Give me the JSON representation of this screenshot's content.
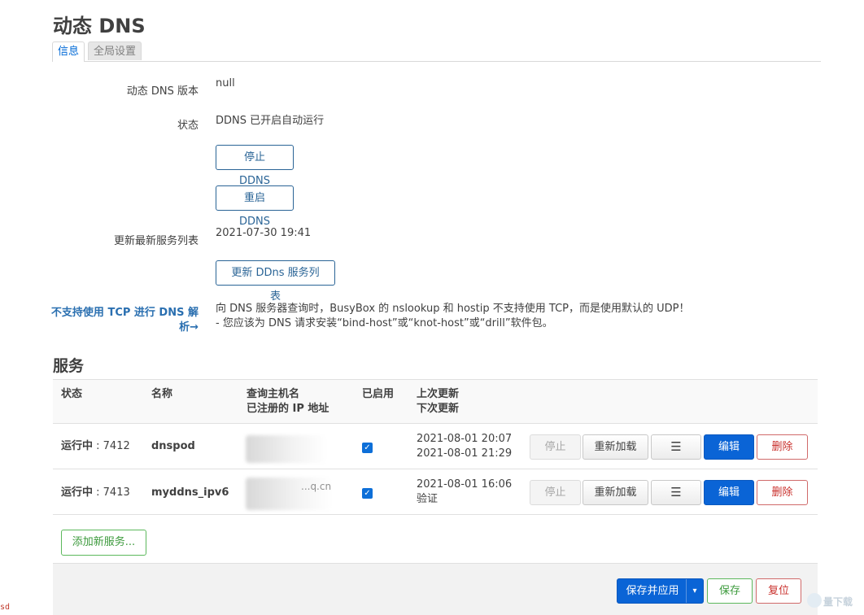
{
  "page": {
    "title": "动态 DNS",
    "tabs": [
      {
        "label": "信息",
        "active": true
      },
      {
        "label": "全局设置",
        "active": false
      }
    ]
  },
  "info": {
    "version_label": "动态 DNS 版本",
    "version_value": "null",
    "status_label": "状态",
    "status_value": "DDNS 已开启自动运行",
    "stop_button": "停止 DDNS",
    "restart_button": "重启 DDNS",
    "update_list_label": "更新最新服务列表",
    "update_list_value": "2021-07-30 19:41",
    "update_list_button": "更新 DDns 服务列表",
    "tcp_warning_label": "不支持使用 TCP 进行 DNS 解析→",
    "tcp_warning_line1": "向 DNS 服务器查询时，BusyBox 的 nslookup 和 hostip 不支持使用 TCP，而是使用默认的 UDP！",
    "tcp_warning_line2": "- 您应该为 DNS 请求安装“bind-host”或“knot-host”或“drill”软件包。"
  },
  "services": {
    "title": "服务",
    "headers": {
      "status": "状态",
      "name": "名称",
      "host_line1": "查询主机名",
      "host_line2": "已注册的 IP 地址",
      "enabled": "已启用",
      "update_line1": "上次更新",
      "update_line2": "下次更新"
    },
    "rows": [
      {
        "status_label": "运行中",
        "status_pid": " : 7412",
        "name": "dnspod",
        "host_fragment": "",
        "enabled": true,
        "last_update": "2021-08-01 20:07",
        "next_update": "2021-08-01 21:29"
      },
      {
        "status_label": "运行中",
        "status_pid": " : 7413",
        "name": "myddns_ipv6",
        "host_fragment": "...q.cn",
        "enabled": true,
        "last_update": "2021-08-01 16:06",
        "next_update": "验证"
      }
    ],
    "row_actions": {
      "stop": "停止",
      "reload": "重新加载",
      "log_icon": "☰",
      "edit": "编辑",
      "delete": "删除"
    },
    "add_button": "添加新服务..."
  },
  "footer": {
    "save_apply": "保存并应用",
    "dropdown_caret": "▾",
    "save": "保存",
    "reset": "复位"
  },
  "corner_text": "sd",
  "watermark_text": "量下载"
}
